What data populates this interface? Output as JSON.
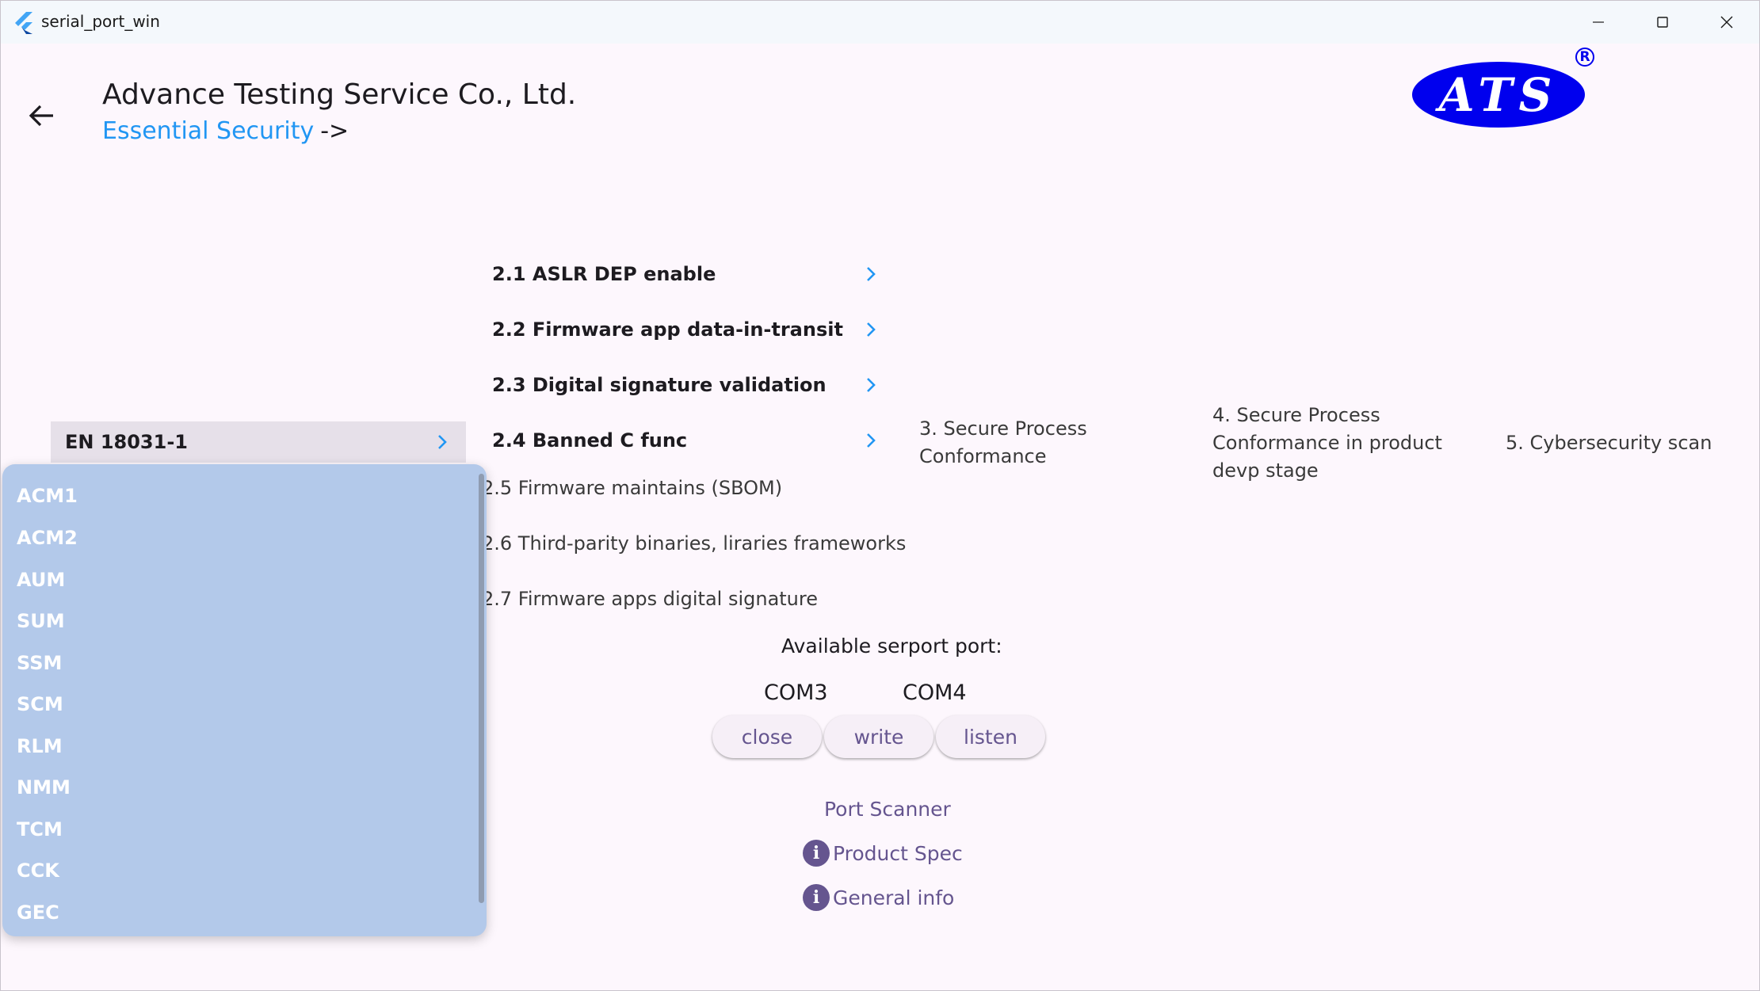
{
  "window": {
    "title": "serial_port_win",
    "controls": [
      "minimize-icon",
      "maximize-icon",
      "close-icon"
    ]
  },
  "header": {
    "company": "Advance Testing Service Co., Ltd.",
    "breadcrumb_link": "Essential Security",
    "breadcrumb_arrow": "->",
    "logo_text": "ATS",
    "logo_reg": "R"
  },
  "colors": {
    "accent_link": "#2196f3",
    "logo_blue": "#0000ee",
    "button_text": "#65558f",
    "dropdown_bg": "#b3c9ea"
  },
  "standard": {
    "selected": "EN 18031-1",
    "options": [
      "ACM1",
      "ACM2",
      "AUM",
      "SUM",
      "SSM",
      "SCM",
      "RLM",
      "NMM",
      "TCM",
      "CCK",
      "GEC"
    ]
  },
  "section2": {
    "items": [
      "2.1 ASLR DEP enable",
      "2.2 Firmware app data-in-transit",
      "2.3 Digital signature validation",
      "2.4 Banned C func"
    ],
    "plain": [
      "2.5 Firmware maintains (SBOM)",
      "2.6 Third-parity binaries, liraries frameworks",
      "2.7 Firmware apps digital signature"
    ]
  },
  "columns": {
    "col3": [
      "3. Secure Process",
      "Conformance"
    ],
    "col4": [
      "4. Secure Process",
      "Conformance in product",
      "devp stage"
    ],
    "col5": "5. Cybersecurity scan"
  },
  "serial": {
    "available_label": "Available serport port:",
    "ports": [
      "COM3",
      "COM4"
    ],
    "buttons": {
      "close": "close",
      "write": "write",
      "listen": "listen"
    },
    "port_scanner": "Port Scanner",
    "product_spec": "Product Spec",
    "general_info": "General info"
  }
}
